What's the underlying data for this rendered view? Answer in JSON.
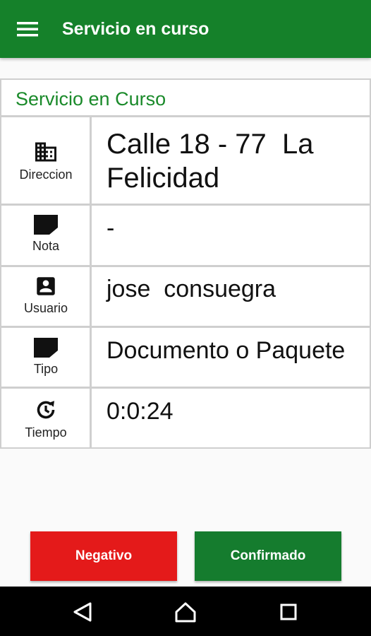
{
  "appbar": {
    "title": "Servicio en curso",
    "menu_icon": "menu-icon"
  },
  "card": {
    "title": "Servicio en Curso",
    "rows": [
      {
        "icon": "building-icon",
        "label": "Direccion",
        "value_line1": "Calle 18 - 77  La",
        "value_line2": "Felicidad"
      },
      {
        "icon": "note-icon",
        "label": "Nota",
        "value": "-"
      },
      {
        "icon": "account-box-icon",
        "label": "Usuario",
        "value": "jose  consuegra"
      },
      {
        "icon": "note-icon",
        "label": "Tipo",
        "value": "Documento o Paquete"
      },
      {
        "icon": "timer-icon",
        "label": "Tiempo",
        "value": "0:0:24"
      }
    ]
  },
  "buttons": {
    "negative": "Negativo",
    "confirm": "Confirmado"
  },
  "colors": {
    "primary": "#15812a",
    "negative": "#e41a1a",
    "confirm": "#157c2e",
    "title_green": "#1a8a2a"
  },
  "navbar": {
    "back_icon": "back-triangle-icon",
    "home_icon": "home-icon",
    "recents_icon": "recents-square-icon"
  }
}
